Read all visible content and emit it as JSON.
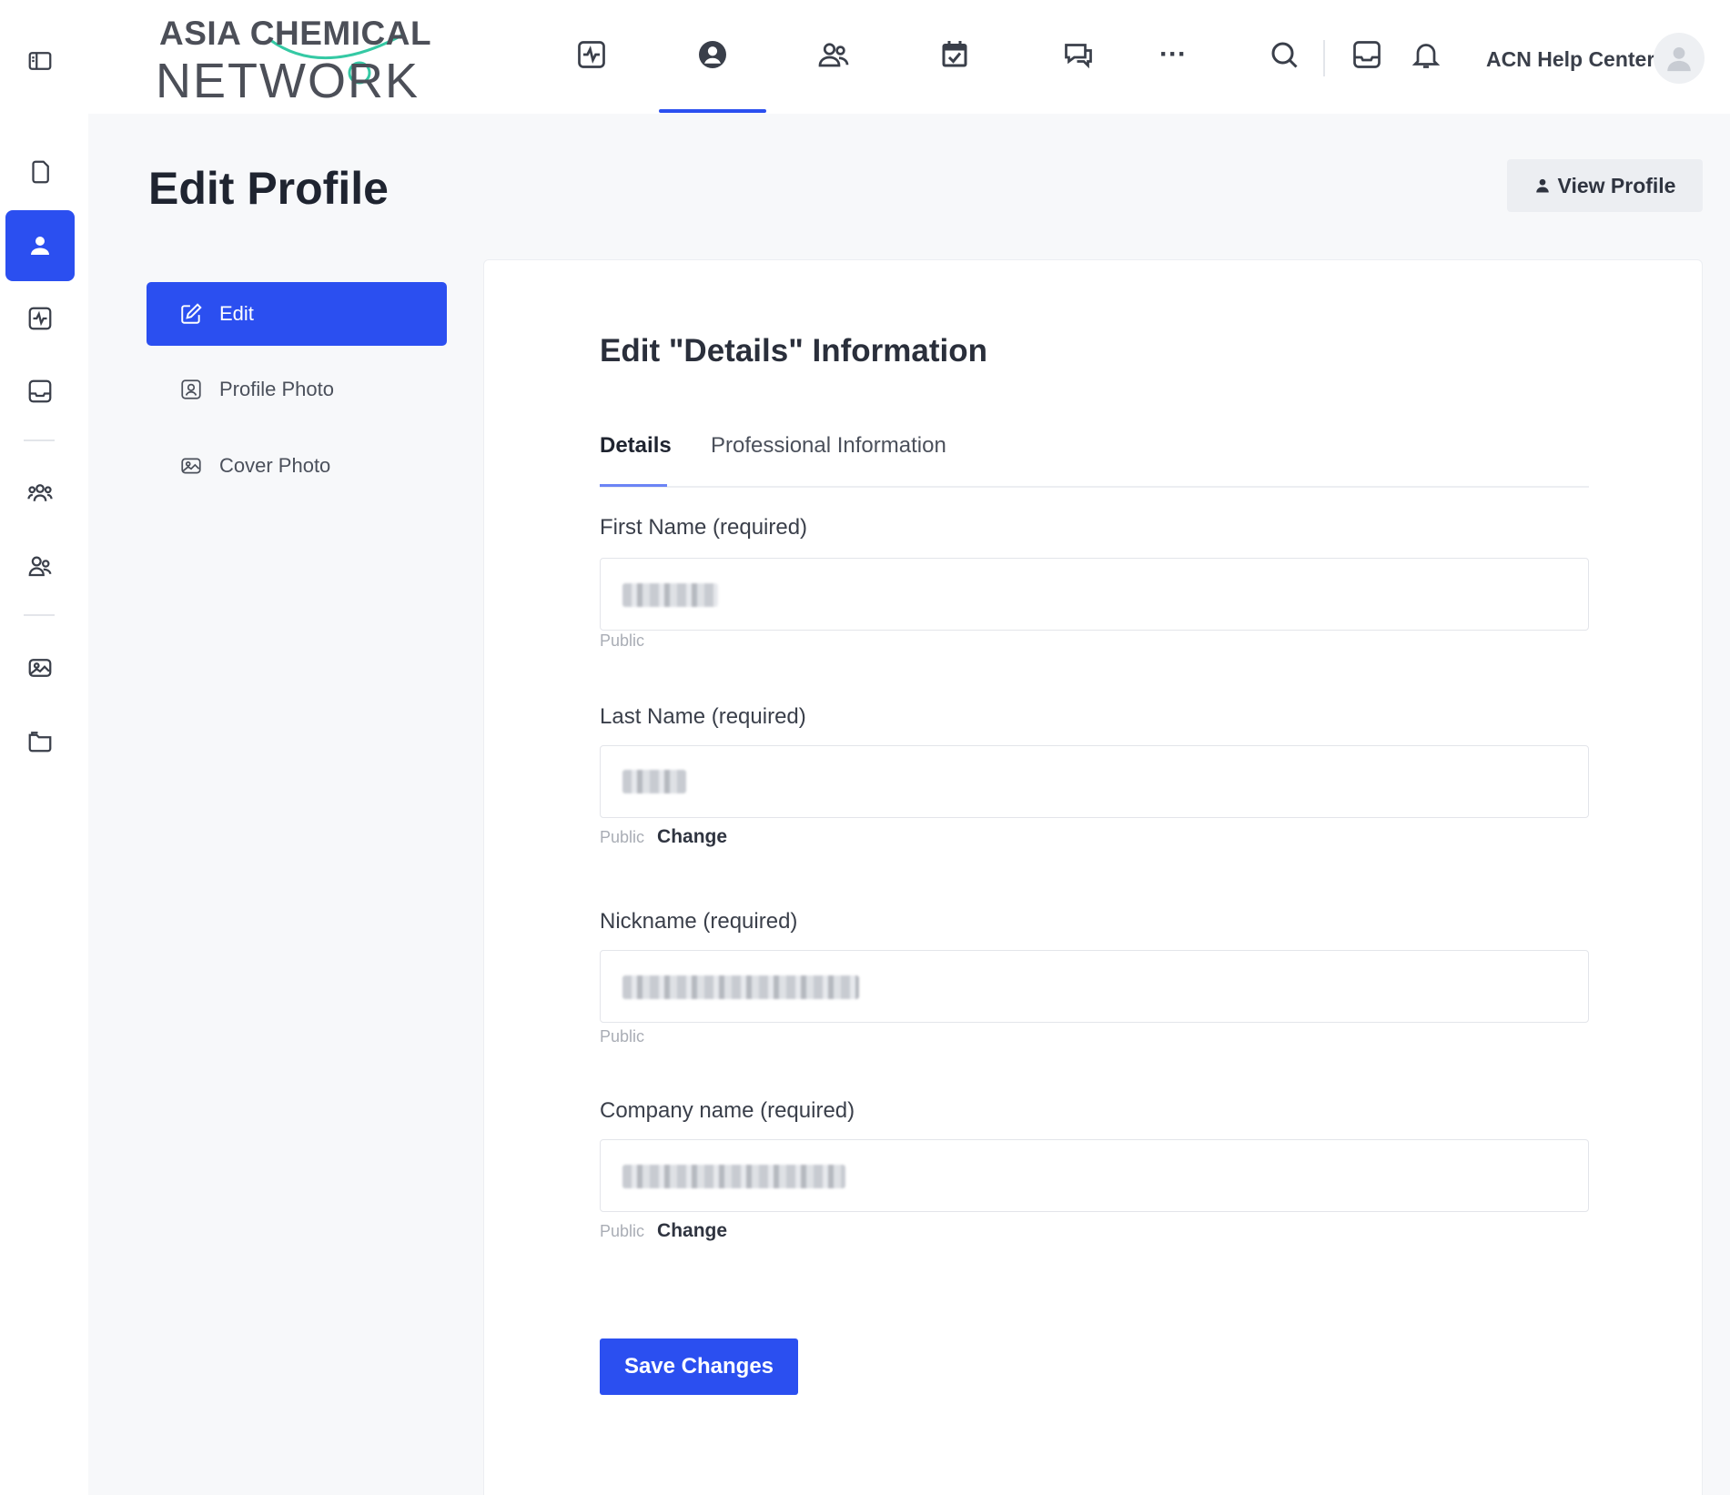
{
  "brand": {
    "logo_line1": "ASIA CHEMICAL",
    "logo_line2": "NETWORK",
    "accent_color": "#2b4ff0",
    "logo_accent_color": "#35c9a4"
  },
  "rail": {
    "items": [
      {
        "icon": "panel-toggle-icon"
      },
      {
        "icon": "document-icon"
      },
      {
        "icon": "profile-icon",
        "active": true
      },
      {
        "icon": "activity-icon"
      },
      {
        "icon": "inbox-icon"
      },
      {
        "icon": "groups-icon"
      },
      {
        "icon": "friends-icon"
      },
      {
        "icon": "photos-icon"
      },
      {
        "icon": "folder-icon"
      }
    ]
  },
  "topnav": {
    "icons": [
      "activity-icon",
      "profile-icon",
      "members-icon",
      "calendar-icon",
      "messages-icon",
      "more-icon",
      "search-icon",
      "inbox-icon",
      "bell-icon"
    ],
    "active": "profile-icon",
    "more_label": "···",
    "help_center": "ACN Help Center"
  },
  "page": {
    "title": "Edit Profile",
    "view_profile": "View Profile"
  },
  "subnav": {
    "items": [
      {
        "label": "Edit",
        "icon": "edit-icon",
        "active": true
      },
      {
        "label": "Profile Photo",
        "icon": "profile-photo-icon"
      },
      {
        "label": "Cover Photo",
        "icon": "cover-photo-icon"
      }
    ]
  },
  "form": {
    "title": "Edit \"Details\" Information",
    "tabs": [
      {
        "label": "Details",
        "active": true
      },
      {
        "label": "Professional Information"
      }
    ],
    "fields": [
      {
        "label": "First Name (required)",
        "visibility": "Public",
        "change": ""
      },
      {
        "label": "Last Name (required)",
        "visibility": "Public",
        "change": "Change"
      },
      {
        "label": "Nickname (required)",
        "visibility": "Public",
        "change": ""
      },
      {
        "label": "Company name (required)",
        "visibility": "Public",
        "change": "Change"
      }
    ],
    "save_label": "Save Changes"
  }
}
